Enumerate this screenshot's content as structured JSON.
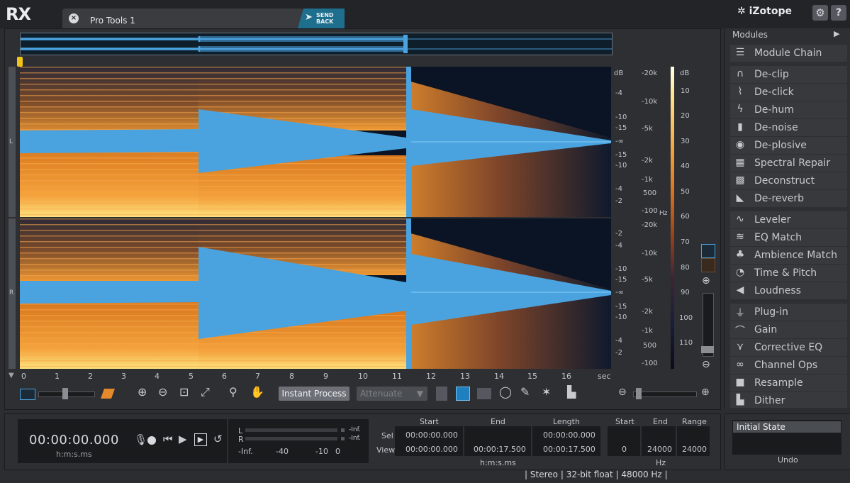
{
  "app": {
    "logo": "RX",
    "brand": "iZotope"
  },
  "tab": {
    "title": "Pro Tools 1",
    "close_icon": "×",
    "send_back_label": "SEND BACK"
  },
  "header": {
    "gear_icon": "⚙",
    "help_icon": "?"
  },
  "channels": {
    "left": "L",
    "right": "R"
  },
  "db_scale_L": [
    "dB",
    "-4",
    "-10",
    "-15",
    "-∞",
    "-15",
    "-10",
    "-4",
    "-2"
  ],
  "db_scale_R": [
    "-2",
    "-4",
    "-10",
    "-15",
    "-∞",
    "-15",
    "-10",
    "-4",
    "-2",
    "-100"
  ],
  "hz_scale_L": [
    "-20k",
    "-10k",
    "-5k",
    "-2k",
    "-1k",
    "500",
    "-100"
  ],
  "hz_scale_R": [
    "-20k",
    "-10k",
    "-5k",
    "-2k",
    "-1k",
    "500",
    "-100"
  ],
  "hz_unit": "Hz",
  "color_scale": [
    "dB",
    "10",
    "20",
    "30",
    "40",
    "50",
    "60",
    "70",
    "80",
    "90",
    "100",
    "110"
  ],
  "time_axis": {
    "ticks": [
      "0",
      "1",
      "2",
      "3",
      "4",
      "5",
      "6",
      "7",
      "8",
      "9",
      "10",
      "11",
      "12",
      "13",
      "14",
      "15",
      "16"
    ],
    "unit": "sec"
  },
  "toolbar": {
    "instant_process": "Instant Process",
    "attenuate": "Attenuate"
  },
  "modules": {
    "header": "Modules",
    "items": [
      {
        "label": "Module Chain",
        "icon": "☰"
      },
      {
        "label": "De-clip",
        "icon": "∩"
      },
      {
        "label": "De-click",
        "icon": "⌇"
      },
      {
        "label": "De-hum",
        "icon": "ϟ"
      },
      {
        "label": "De-noise",
        "icon": "▮"
      },
      {
        "label": "De-plosive",
        "icon": "◉"
      },
      {
        "label": "Spectral Repair",
        "icon": "▦"
      },
      {
        "label": "Deconstruct",
        "icon": "▩"
      },
      {
        "label": "De-reverb",
        "icon": "◣"
      },
      {
        "label": "Leveler",
        "icon": "∿"
      },
      {
        "label": "EQ Match",
        "icon": "≋"
      },
      {
        "label": "Ambience Match",
        "icon": "♣"
      },
      {
        "label": "Time & Pitch",
        "icon": "◔"
      },
      {
        "label": "Loudness",
        "icon": "◀"
      },
      {
        "label": "Plug-in",
        "icon": "⏚"
      },
      {
        "label": "Gain",
        "icon": "⌒"
      },
      {
        "label": "Corrective EQ",
        "icon": "⋎"
      },
      {
        "label": "Channel Ops",
        "icon": "∞"
      },
      {
        "label": "Resample",
        "icon": "■"
      },
      {
        "label": "Dither",
        "icon": "▙"
      }
    ]
  },
  "transport": {
    "time": "00:00:00.000",
    "time_unit": "h:m:s.ms"
  },
  "meter": {
    "L": "L",
    "R": "R",
    "inf_top": "-Inf.",
    "inf_bottom": "-Inf.",
    "scale": [
      "-Inf.",
      "-40",
      "-10",
      "0"
    ]
  },
  "selection": {
    "headers": {
      "start": "Start",
      "end": "End",
      "length": "Length"
    },
    "row_sel": "Sel",
    "row_view": "View",
    "sel": {
      "start": "00:00:00.000",
      "end": "",
      "length": "00:00:00.000"
    },
    "view": {
      "start": "00:00:00.000",
      "end": "00:00:17.500",
      "length": "00:00:17.500"
    },
    "unit": "h:m:s.ms"
  },
  "freq": {
    "headers": {
      "start": "Start",
      "end": "End",
      "range": "Range"
    },
    "values": {
      "start": "0",
      "end": "24000",
      "range": "24000"
    },
    "unit": "Hz"
  },
  "undo": {
    "item": "Initial State",
    "label": "Undo"
  },
  "status": {
    "channels": "Stereo",
    "bit_depth": "32-bit float",
    "sample_rate": "48000 Hz"
  },
  "colors": {
    "waveform": "#4aa3df",
    "accent_tab": "#1e6f8e",
    "spectrum_hot": "#f5a23b"
  }
}
